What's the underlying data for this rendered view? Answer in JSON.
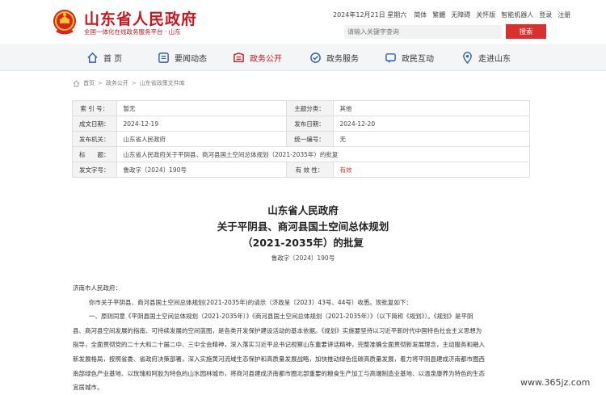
{
  "header": {
    "site_title": "山东省人民政府",
    "site_subtitle": "全国一体化在线政务服务平台 · 山东",
    "date": "2024年12月21日 星期六",
    "links": [
      "简体",
      "繁體",
      "无障碍",
      "关怀版",
      "智能机器人",
      "登录",
      "注册"
    ],
    "search_placeholder": "请输入关键字查询",
    "search_button": "搜索",
    "brand_color": "#c8161d"
  },
  "nav": {
    "items": [
      {
        "label": "首 页",
        "icon": "home-icon"
      },
      {
        "label": "要闻动态",
        "icon": "news-icon"
      },
      {
        "label": "政务公开",
        "icon": "open-gov-icon",
        "active": true
      },
      {
        "label": "政务服务",
        "icon": "service-icon"
      },
      {
        "label": "政民互动",
        "icon": "interaction-icon"
      },
      {
        "label": "走进山东",
        "icon": "location-icon"
      }
    ]
  },
  "breadcrumb": [
    "首页",
    "政务公开",
    "山东省政策文件库"
  ],
  "meta": {
    "rows": [
      {
        "l1": "索 引 号：",
        "v1": "暂无",
        "l2": "主题分类：",
        "v2": "其他"
      },
      {
        "l1": "成文日期：",
        "v1": "2024-12-19",
        "l2": "发布日期：",
        "v2": "2024-12-20"
      },
      {
        "l1": "发布机关：",
        "v1": "山东省人民政府",
        "l2": "统一编号：",
        "v2": "无"
      }
    ],
    "title_label": "标　　题：",
    "title_value": "山东省人民政府关于平阴县、商河县国土空间总体规划（2021-2035年）的批复",
    "docno_label": "发文字号：",
    "docno_value": "鲁政字〔2024〕190号",
    "valid_label": "有 效 性：",
    "valid_value": "有效"
  },
  "document": {
    "title_line1": "山东省人民政府",
    "title_line2": "关于平阴县、商河县国土空间总体规划",
    "title_line3": "（2021-2035年）的批复",
    "doc_number": "鲁政字〔2024〕190号",
    "salutation": "济南市人民政府：",
    "para1": "你市关于平阴县、商河县国土空间总体规划(2021-2035年)的请示（济政呈〔2023〕43号、44号）收悉。现批复如下：",
    "para2_l1": "一、原则同意《平阴县国土空间总体规划（2021-2035年）》《商河县国土空间总体规划（2021-2035年）》（以下简称《规划》）。《规划》是平阴",
    "para2_l2": "县、商河县空间发展的指南、可持续发展的空间蓝图，是各类开发保护建设活动的基本依据。《规划》实施要坚持以习近平新时代中国特色社会主义思想为",
    "para2_l3": "指导，全面贯彻党的二十大和二十届二中、三中全会精神，深入落实习近平总书记视察山东重要讲话精神，完整准确全面贯彻新发展理念，主动服务和融入",
    "para2_l4": "新发展格局，按照省委、省政府决策部署，深入实施黄河流域生态保护和高质量发展战略，加快推动绿色低碳高质量发展，着力将平阴县建成济南都市圈西",
    "para2_l5": "南部绿色产业基地、以玫瑰和阿胶为特色的山水园林城市，将商河县建成济南都市圈北部重要的粮食生产加工与高端制造业基地、以温泉康养为特色的生态",
    "para2_l6": "宜居城市。"
  },
  "watermark": "www.365jz.com"
}
